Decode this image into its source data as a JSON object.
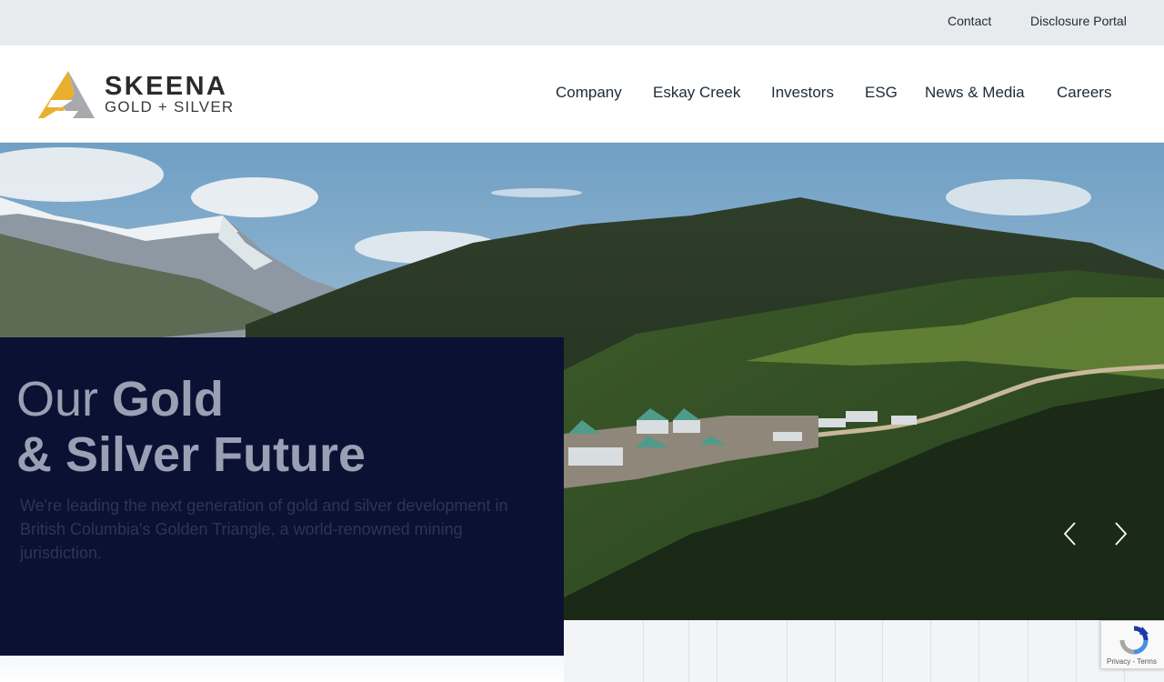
{
  "utility_nav": {
    "contact": "Contact",
    "disclosure_portal": "Disclosure Portal"
  },
  "logo": {
    "wordmark": "SKEENA",
    "subtitle": "GOLD + SILVER",
    "colors": {
      "gold": "#e9b030",
      "grey": "#a7a9ac",
      "text": "#2b2b2b"
    }
  },
  "main_nav": {
    "company": "Company",
    "eskay_creek": "Eskay Creek",
    "investors": "Investors",
    "esg": "ESG",
    "news_media": "News & Media",
    "careers": "Careers"
  },
  "hero": {
    "title_light": "Our ",
    "title_bold_1": "Gold",
    "title_bold_2": "& Silver Future",
    "body": "We're leading the next generation of gold and silver development in British Columbia's Golden Triangle, a world-renowned mining jurisdiction.",
    "image": "aerial-mountain-mine-camp-photo",
    "panel_color": "#0a1133",
    "prev_icon": "chevron-left-icon",
    "next_icon": "chevron-right-icon"
  },
  "recaptcha": {
    "icon": "recaptcha-icon",
    "label": "Privacy - Terms"
  }
}
